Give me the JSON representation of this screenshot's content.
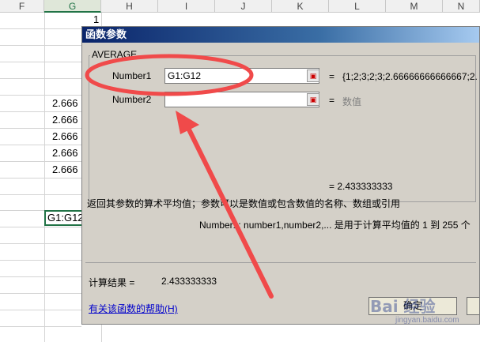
{
  "sheet": {
    "columns": [
      "F",
      "G",
      "H",
      "I",
      "J",
      "K",
      "L",
      "M",
      "N"
    ],
    "active_column": "G",
    "row1_value": "1",
    "g_values": [
      "2.666",
      "2.666",
      "2.666",
      "2.666",
      "2.666"
    ],
    "editing_cell": "G1:G12"
  },
  "dialog": {
    "title": "函数参数",
    "function_name": "AVERAGE",
    "number1_label": "Number1",
    "number1_value": "G1:G12",
    "number1_result": "{1;2;3;2;3;2.66666666666667;2.",
    "number2_label": "Number2",
    "number2_value": "",
    "number2_result": "数值",
    "equals": "=",
    "formula_result": "= 2.433333333",
    "description": "返回其参数的算术平均值；参数可以是数值或包含数值的名称、数组或引用",
    "arg_description": "Number1:  number1,number2,... 是用于计算平均值的 1 到 255 个",
    "calc_result_label": "计算结果 =",
    "calc_result_value": "2.433333333",
    "help_link": "有关该函数的帮助(H)",
    "ok_button": "确定",
    "cancel_button": ""
  },
  "watermark": {
    "text": "Bai 经验",
    "sub": "jingyan.baidu.com"
  },
  "colors": {
    "annotation_red": "#f04a4a",
    "excel_green": "#217346"
  }
}
